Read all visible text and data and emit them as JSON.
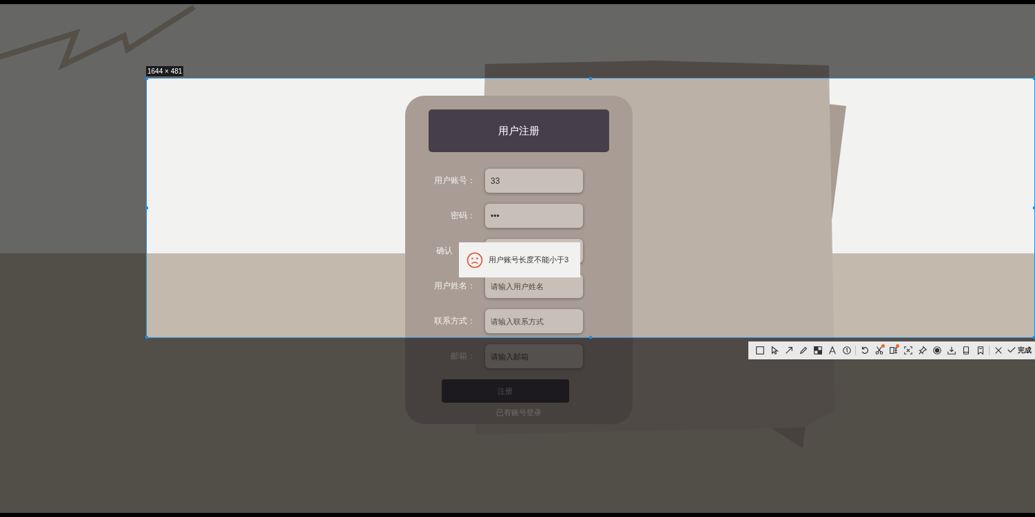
{
  "capture": {
    "size_label": "1644 × 481",
    "toolbar": {
      "groups": [
        [
          {
            "kind": "rect"
          },
          {
            "kind": "pointer"
          },
          {
            "kind": "arrow"
          },
          {
            "kind": "pencil"
          },
          {
            "kind": "mosaic"
          },
          {
            "kind": "text"
          },
          {
            "kind": "number"
          }
        ],
        [
          {
            "kind": "undo"
          },
          {
            "kind": "scissors",
            "badge": true
          },
          {
            "kind": "ocr",
            "badge": true
          },
          {
            "kind": "scan"
          },
          {
            "kind": "pin"
          },
          {
            "kind": "record"
          },
          {
            "kind": "download"
          },
          {
            "kind": "phone"
          },
          {
            "kind": "bookmark"
          }
        ],
        [
          {
            "kind": "close"
          },
          {
            "kind": "check"
          }
        ]
      ],
      "done": "完成"
    }
  },
  "form": {
    "title": "用户注册",
    "fields": [
      {
        "label": "用户账号：",
        "value": "33"
      },
      {
        "label": "密码：",
        "value": "•••"
      },
      {
        "label": "确认",
        "covered": true
      },
      {
        "label": "用户姓名：",
        "placeholder": "请输入用户姓名"
      },
      {
        "label": "联系方式：",
        "placeholder": "请输入联系方式"
      },
      {
        "label": "邮箱：",
        "placeholder": "请输入邮箱"
      }
    ],
    "submit": "注册",
    "login_link": "已有账号登录"
  },
  "toast": {
    "message": "用户账号长度不能小于3"
  }
}
